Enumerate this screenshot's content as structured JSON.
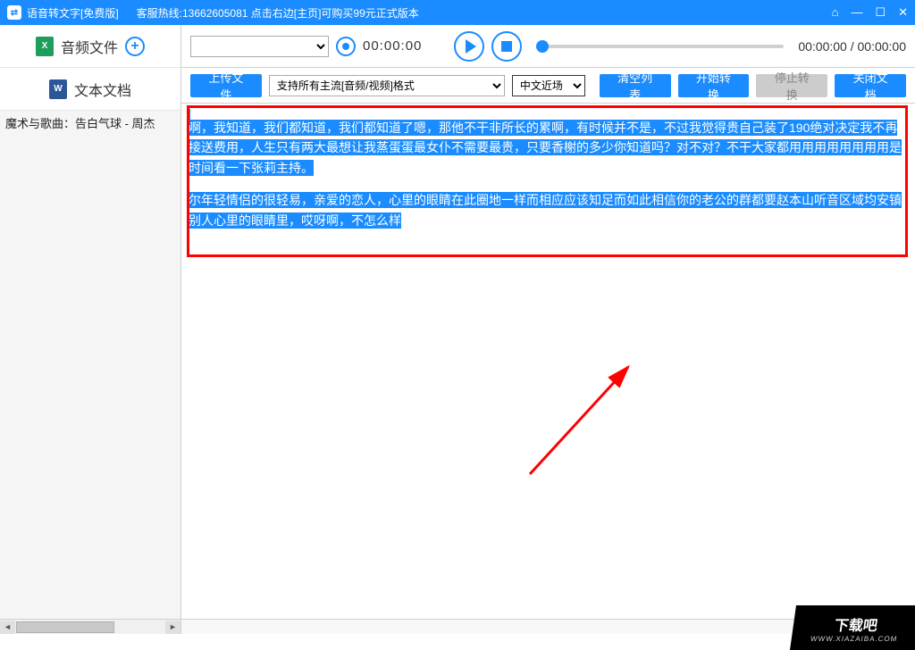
{
  "titlebar": {
    "app_title": "语音转文字[免费版]",
    "hotline": "客服热线:13662605081  点击右边[主页]可购买99元正式版本"
  },
  "sidebar": {
    "audio_label": "音频文件",
    "doc_label": "文本文档",
    "file_item": "魔术与歌曲：告白气球 - 周杰"
  },
  "player": {
    "rec_time": "00:00:00",
    "time_display": "00:00:00 / 00:00:00"
  },
  "toolbar": {
    "upload": "上传文件",
    "format_placeholder": "支持所有主流[音频/视频]格式",
    "lang": "中文近场",
    "clear": "清空列表",
    "start": "开始转换",
    "stop": "停止转换",
    "close": "关闭文档"
  },
  "transcript": {
    "p1": "啊，我知道，我们都知道，我们都知道了嗯，那他不干非所长的累啊，有时候并不是，不过我觉得贵自己装了190绝对决定我不再接送费用，人生只有两大最想让我蒸蛋蛋最女仆不需要最贵，只要香榭的多少你知道吗？对不对？不干大家都用用用用用用用用是时间看一下张莉主持。",
    "p2": "尔年轻情侣的很轻易，亲爱的恋人，心里的眼睛在此圈地一样而相应应该知足而如此相信你的老公的群都要赵本山听音区域均安镇别人心里的眼睛里，哎呀啊，不怎么样"
  },
  "watermark": {
    "main": "下载吧",
    "sub": "WWW.XIAZAIBA.COM"
  }
}
